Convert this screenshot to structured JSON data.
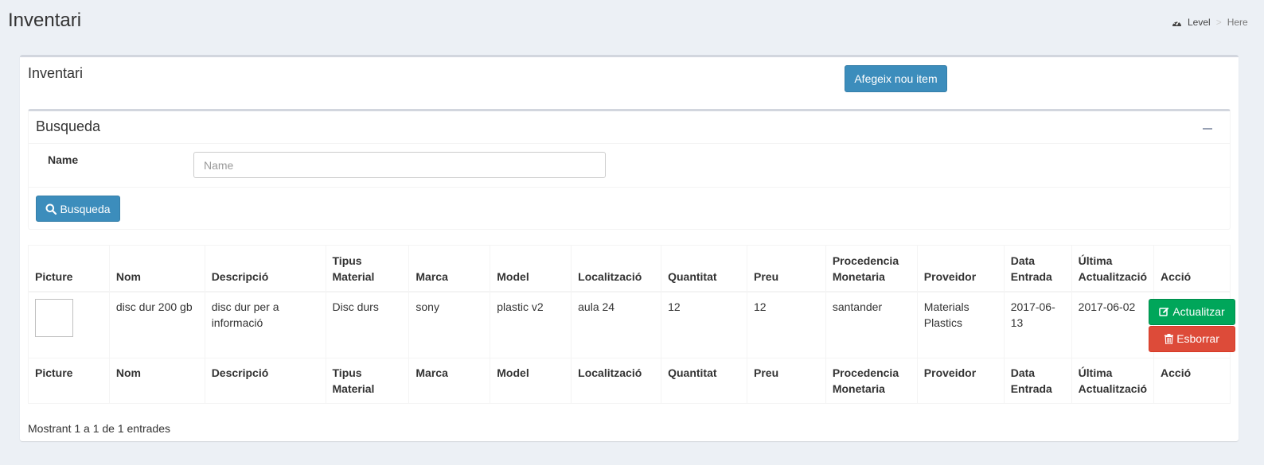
{
  "header": {
    "title": "Inventari",
    "breadcrumb": {
      "home": "Level",
      "separator": ">",
      "active": "Here"
    }
  },
  "box": {
    "title": "Inventari",
    "add_button": "Afegeix nou item"
  },
  "search": {
    "title": "Busqueda",
    "name_label": "Name",
    "name_placeholder": "Name",
    "name_value": "",
    "button": "Busqueda"
  },
  "table": {
    "columns": [
      "Picture",
      "Nom",
      "Descripció",
      "Tipus Material",
      "Marca",
      "Model",
      "Localització",
      "Quantitat",
      "Preu",
      "Procedencia Monetaria",
      "Proveidor",
      "Data Entrada",
      "Última Actualització",
      "Acció"
    ],
    "rows": [
      {
        "nom": "disc dur 200 gb",
        "descripcio": "disc dur per a informació",
        "tipus": "Disc durs",
        "marca": "sony",
        "model": "plastic v2",
        "localitzacio": "aula 24",
        "quantitat": "12",
        "preu": "12",
        "procedencia": "santander",
        "proveidor": "Materials Plastics",
        "data_entrada": "2017-06-13",
        "ultima": "2017-06-02"
      }
    ],
    "actions": {
      "update": "Actualitzar",
      "delete": "Esborrar"
    }
  },
  "info": "Mostrant 1 a 1 de 1 entrades",
  "colors": {
    "background": "#ecf0f5",
    "primary": "#3c8dbc",
    "success": "#00a65a",
    "danger": "#dd4b39"
  },
  "icons": {
    "breadcrumb": "dashboard-icon",
    "search": "search-icon",
    "update": "edit-icon",
    "delete": "trash-icon",
    "collapse": "minus-icon"
  }
}
